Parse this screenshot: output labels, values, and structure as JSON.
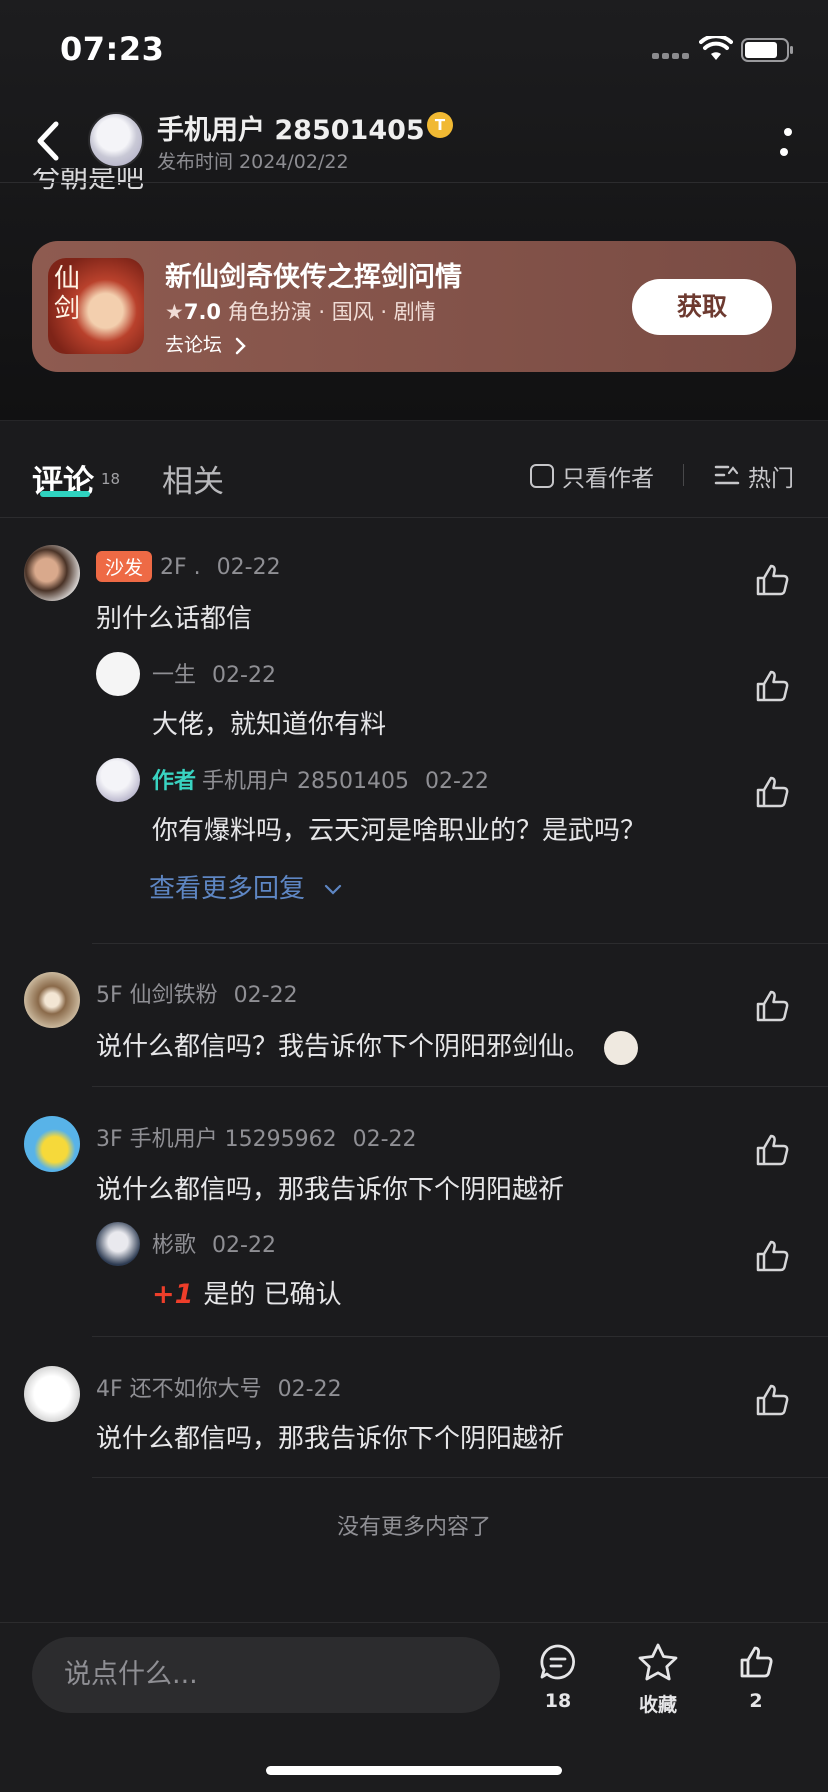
{
  "status_bar": {
    "time": "07:23"
  },
  "header": {
    "author_name": "手机用户 28501405",
    "badge": "T",
    "post_time": "发布时间 2024/02/22",
    "clipped_text": "兮朝是吧"
  },
  "game_card": {
    "title": "新仙剑奇侠传之挥剑问情",
    "rating": "7.0",
    "tags": "角色扮演 · 国风 · 剧情",
    "forum_link": "去论坛",
    "get_button": "获取",
    "icon_glyph": "仙剑"
  },
  "tabs": {
    "comments_label": "评论",
    "comments_count": "18",
    "related_label": "相关",
    "only_author": "只看作者",
    "sort_label": "热门"
  },
  "comments": [
    {
      "tag": "沙发",
      "user": "2F .",
      "date": "02-22",
      "text": "别什么话都信",
      "replies": [
        {
          "user": "一生",
          "date": "02-22",
          "text": "大佬，就知道你有料"
        },
        {
          "author_tag": "作者",
          "user": "手机用户 28501405",
          "date": "02-22",
          "text": "你有爆料吗，云天河是啥职业的？是武吗？"
        }
      ],
      "more_replies": "查看更多回复"
    },
    {
      "user": "5F 仙剑铁粉",
      "date": "02-22",
      "text": "说什么都信吗？我告诉你下个阴阳邪剑仙。"
    },
    {
      "user": "3F 手机用户 15295962",
      "date": "02-22",
      "text": "说什么都信吗，那我告诉你下个阴阳越祈",
      "replies": [
        {
          "user": "彬歌",
          "date": "02-22",
          "sticker": "+1",
          "text": "是的 已确认"
        }
      ]
    },
    {
      "user": "4F 还不如你大号",
      "date": "02-22",
      "text": "说什么都信吗，那我告诉你下个阴阳越祈"
    }
  ],
  "end_text": "没有更多内容了",
  "bottom_bar": {
    "input_placeholder": "说点什么...",
    "comment_count": "18",
    "favorite_label": "收藏",
    "like_count": "2"
  },
  "colors": {
    "background": "#1b1b1d",
    "card": "#8e5b50",
    "accent_teal": "#2fd3c0",
    "link_blue": "#5e86c3",
    "sofa_orange": "#ee6a45"
  }
}
